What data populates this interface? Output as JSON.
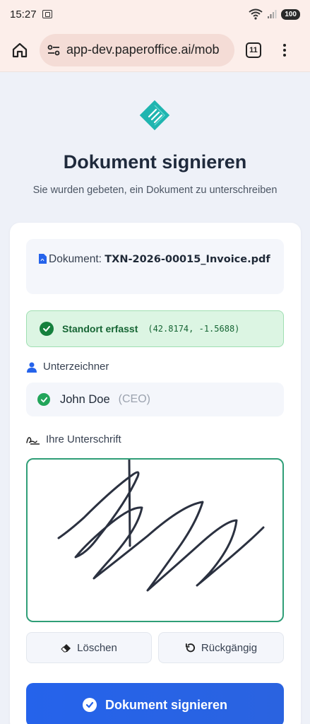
{
  "status_bar": {
    "time": "15:27",
    "battery": "100"
  },
  "browser": {
    "url": "app-dev.paperoffice.ai/mob",
    "tab_count": "11"
  },
  "header": {
    "title": "Dokument signieren",
    "subtitle": "Sie wurden gebeten, ein Dokument zu unterschreiben"
  },
  "document": {
    "label": "Dokument:",
    "filename": "TXN-2026-00015_Invoice.pdf"
  },
  "location": {
    "label": "Standort erfasst",
    "coords": "(42.8174, -1.5688)"
  },
  "signer": {
    "section_label": "Unterzeichner",
    "name": "John Doe",
    "role": "(CEO)"
  },
  "signature": {
    "section_label": "Ihre Unterschrift"
  },
  "actions": {
    "clear_label": "Löschen",
    "undo_label": "Rückgängig",
    "sign_label": "Dokument signieren"
  },
  "colors": {
    "accent": "#2563eb",
    "success": "#22a55a",
    "pad_border": "#2f9e77",
    "logo": "#1fb5b0"
  },
  "icons": [
    "home-icon",
    "tune-icon",
    "menu-dots-icon",
    "pdf-icon",
    "check-circle-icon",
    "user-icon",
    "signature-icon",
    "eraser-icon",
    "undo-icon"
  ]
}
